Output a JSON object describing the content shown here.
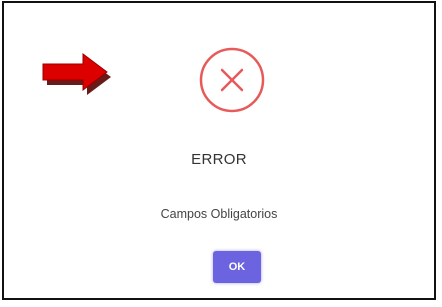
{
  "dialog": {
    "icon": "error-x-circle-icon",
    "title": "ERROR",
    "message": "Campos Obligatorios",
    "ok_label": "OK"
  },
  "annotation": {
    "icon": "arrow-right-icon"
  },
  "colors": {
    "error_red": "#e85a5a",
    "arrow_red": "#dd0000",
    "arrow_shadow": "#6b1a1a",
    "button": "#6c63e0",
    "button_text": "#ffffff",
    "frame_border": "#111111"
  }
}
